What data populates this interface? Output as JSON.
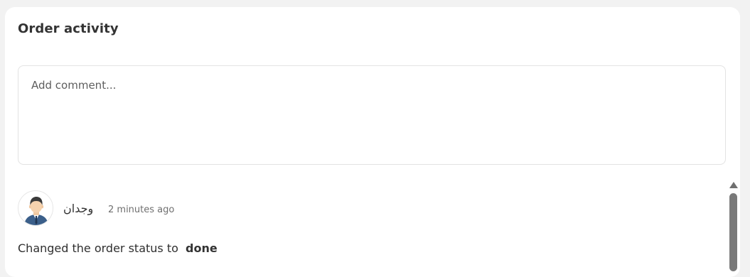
{
  "section": {
    "title": "Order activity"
  },
  "comment": {
    "placeholder": "Add comment...",
    "value": ""
  },
  "activity": {
    "author": "وجدان",
    "time": "2 minutes ago",
    "message": "Changed the order status to",
    "status": "done",
    "avatar_icon": "user-avatar-icon"
  },
  "colors": {
    "background": "#f2f2f2",
    "card": "#ffffff",
    "text": "#333333",
    "muted": "#6f6f6f",
    "scrollbar": "#7a7a7a"
  }
}
